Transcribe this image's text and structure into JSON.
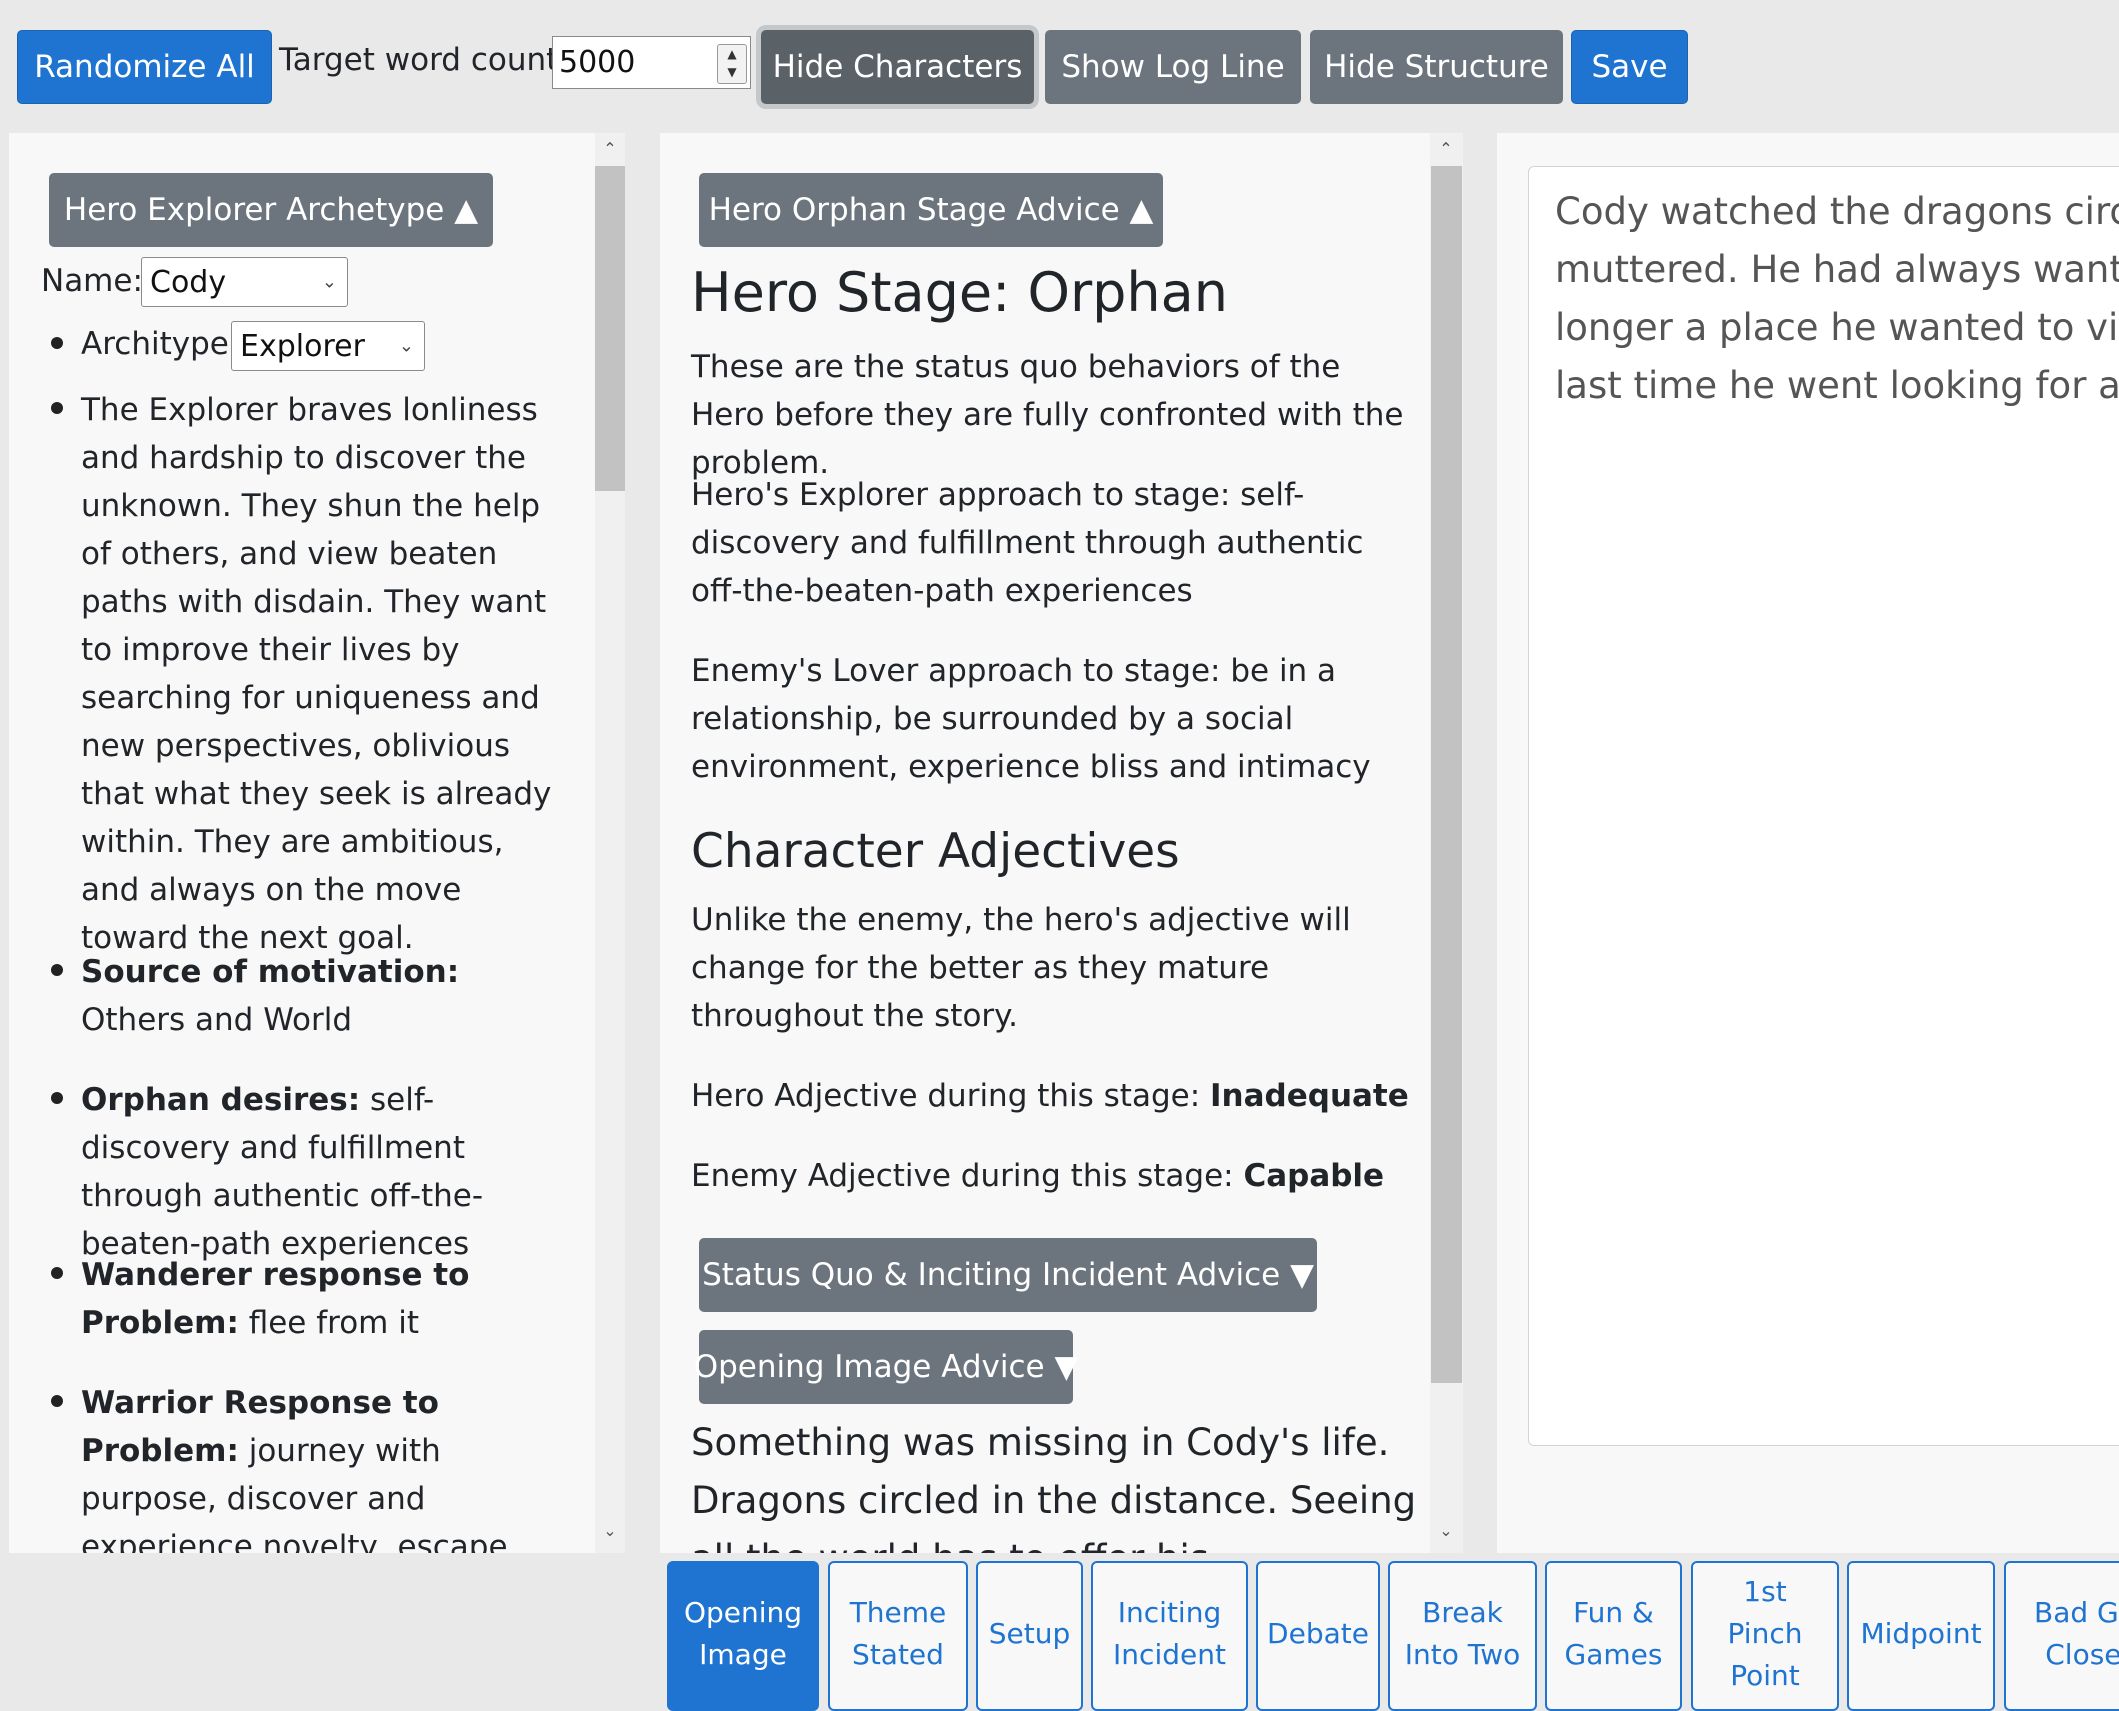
{
  "toolbar": {
    "randomize": "Randomize All",
    "target_label": "Target word count:",
    "target_value": "5000",
    "hide_characters": "Hide Characters",
    "show_log_line": "Show Log Line",
    "hide_structure": "Hide Structure",
    "save": "Save"
  },
  "left": {
    "archetype_button": "Hero Explorer Archetype ▲",
    "name_label": "Name:",
    "name_value": "Cody",
    "archetype_label": "Architype:",
    "archetype_value": "Explorer",
    "description": "The Explorer braves lonliness and hardship to discover the unknown. They shun the help of others, and view beaten paths with disdain. They want to improve their lives by searching for uniqueness and new perspectives, oblivious that what they seek is already within. They are ambitious, and always on the move toward the next goal.",
    "source_key": "Source of motivation:",
    "source_val": " Others and World",
    "orphan_key": "Orphan desires:",
    "orphan_val": " self-discovery and fulfillment through authentic off-the-beaten-path experiences",
    "wanderer_key": "Wanderer response to Problem:",
    "wanderer_val": " flee from it",
    "warrior_key": "Warrior Response to Problem:",
    "warrior_val": " journey with purpose, discover and experience novelty, escape boredom, be true to deeper self"
  },
  "middle": {
    "stage_button": "Hero Orphan Stage Advice ▲",
    "stage_heading": "Hero Stage: Orphan",
    "stage_intro": "These are the status quo behaviors of the Hero before they are fully confronted with the problem.",
    "hero_approach": "Hero's Explorer approach to stage: self-discovery and fulfillment through authentic off-the-beaten-path experiences",
    "enemy_approach": "Enemy's Lover approach to stage: be in a relationship, be surrounded by a social environment, experience bliss and intimacy",
    "adjectives_heading": "Character Adjectives",
    "adjectives_intro": "Unlike the enemy, the hero's adjective will change for the better as they mature throughout the story.",
    "hero_adj_label": "Hero Adjective during this stage: ",
    "hero_adj_value": "Inadequate",
    "enemy_adj_label": "Enemy Adjective during this stage: ",
    "enemy_adj_value": "Capable",
    "status_quo_button": "Status Quo & Inciting Incident Advice ▼",
    "opening_image_button": "Opening Image Advice ▼",
    "log_text": "Something was missing in Cody's life. Dragons circled in the distance. Seeing all the world has to offer his companion"
  },
  "editor": {
    "text": "Cody watched the dragons circling in the distance and muttered. He had always wanted to see the world, but it was no longer a place he wanted to visit after what had happened the last time he went looking for adventure."
  },
  "tabs": [
    {
      "l1": "Opening",
      "l2": "Image",
      "l3": ""
    },
    {
      "l1": "Theme",
      "l2": "Stated",
      "l3": ""
    },
    {
      "l1": "Setup",
      "l2": "",
      "l3": ""
    },
    {
      "l1": "Inciting",
      "l2": "Incident",
      "l3": ""
    },
    {
      "l1": "Debate",
      "l2": "",
      "l3": ""
    },
    {
      "l1": "Break",
      "l2": "Into Two",
      "l3": ""
    },
    {
      "l1": "Fun &",
      "l2": "Games",
      "l3": ""
    },
    {
      "l1": "1st",
      "l2": "Pinch",
      "l3": "Point"
    },
    {
      "l1": "Midpoint",
      "l2": "",
      "l3": ""
    },
    {
      "l1": "Bad Guys",
      "l2": "Close In",
      "l3": ""
    }
  ],
  "colors": {
    "primary": "#1f74d1",
    "secondary": "#6c757d"
  }
}
